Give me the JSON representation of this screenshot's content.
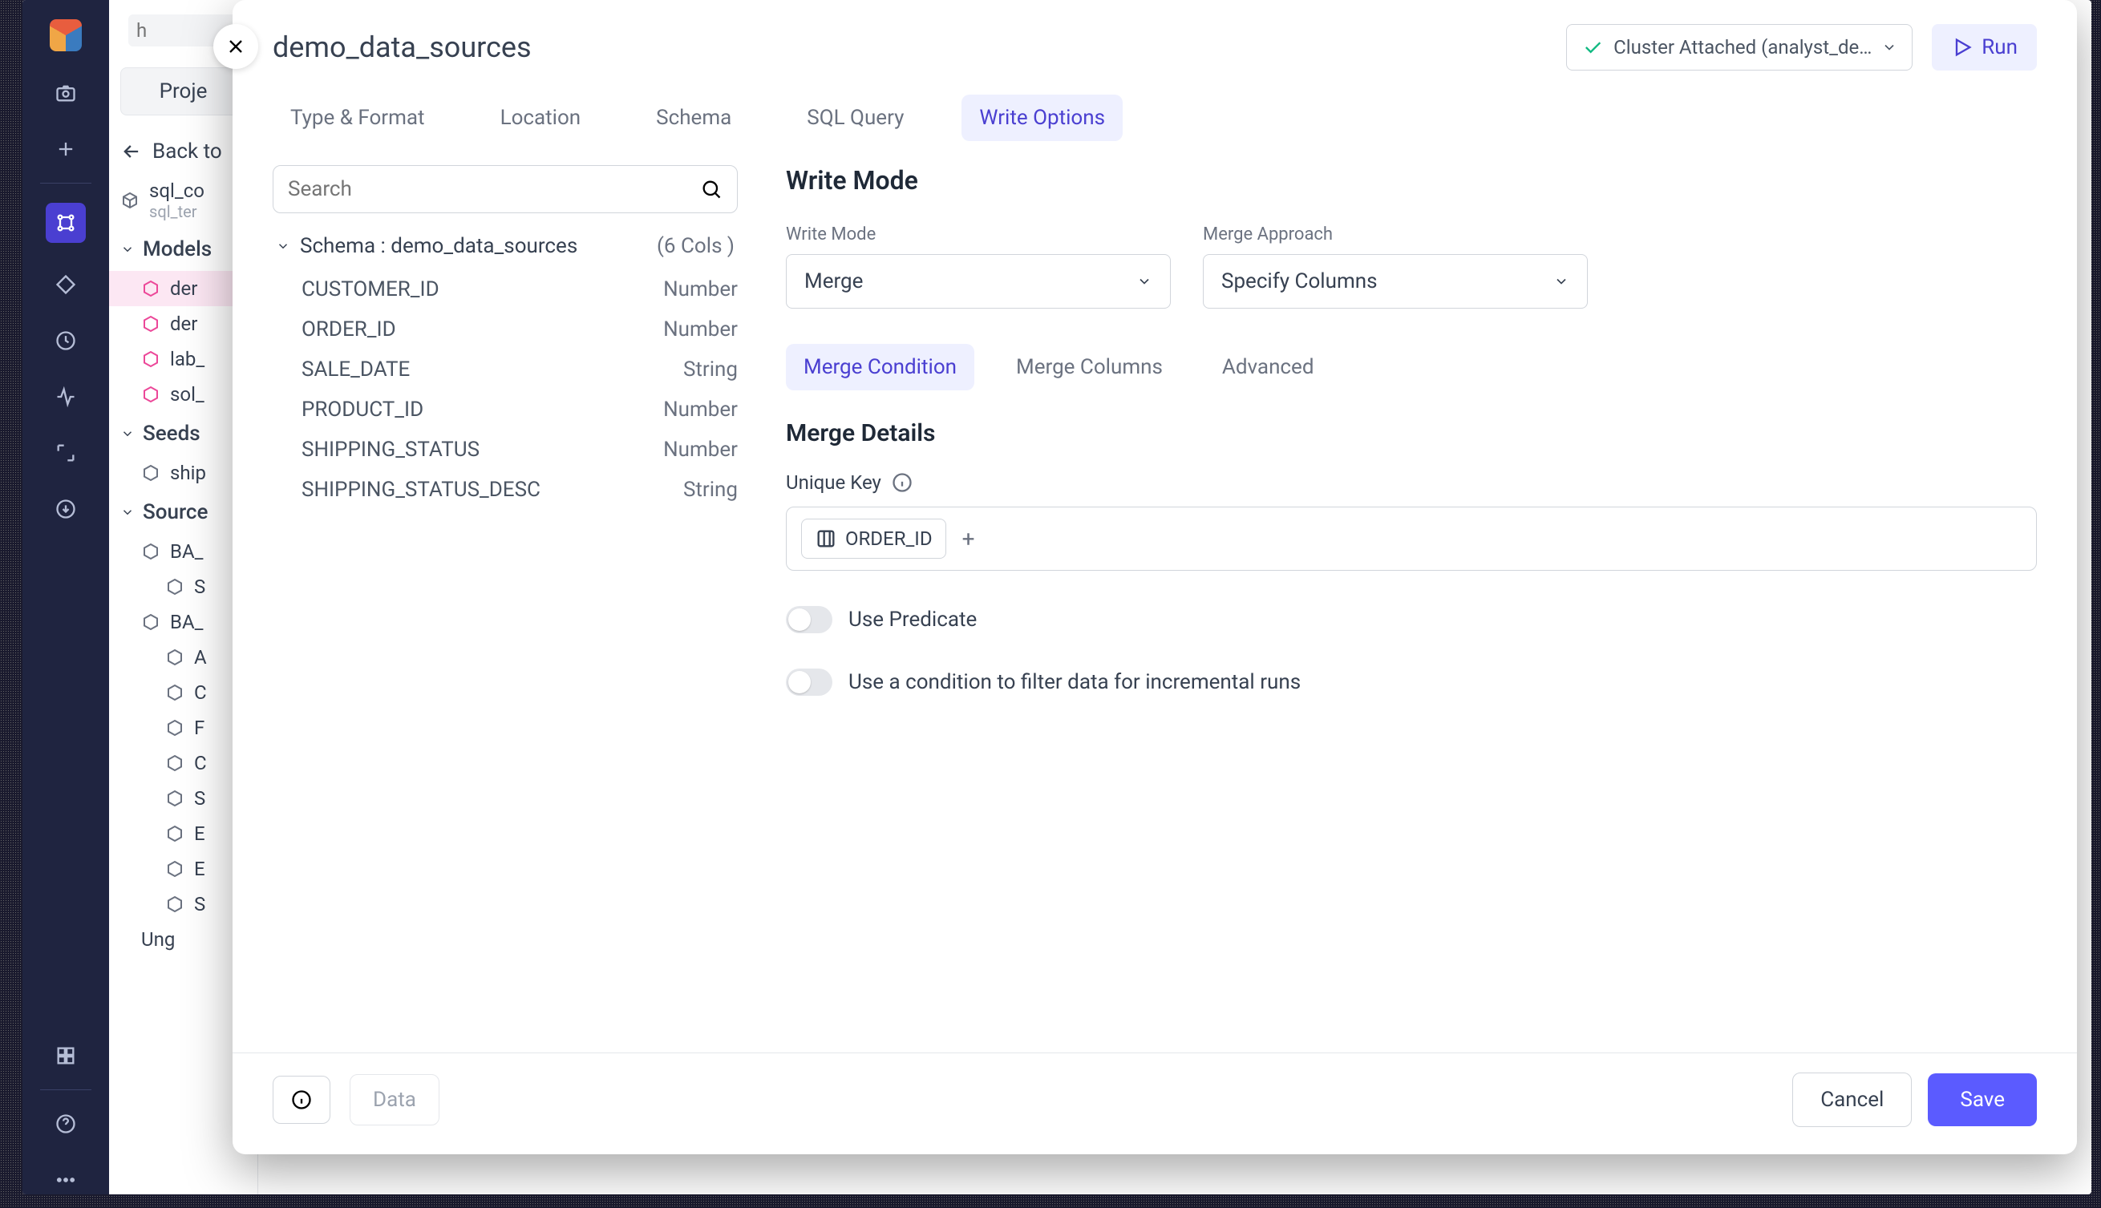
{
  "sidebar": {
    "search_ph": "h",
    "project_btn": "Proje",
    "back_label": "Back to",
    "file_title": "sql_co",
    "file_sub": "sql_ter",
    "sections": {
      "models": "Models",
      "seeds": "Seeds",
      "sources": "Source"
    },
    "models": [
      "der",
      "der",
      "lab_",
      "sol_"
    ],
    "seeds": [
      "ship"
    ],
    "sources_top": [
      "BA_",
      "S",
      "BA_"
    ],
    "sources_sub": [
      "A",
      "C",
      "F",
      "C",
      "S",
      "E",
      "E",
      "S"
    ],
    "sources_last": "Ung"
  },
  "modal": {
    "title": "demo_data_sources",
    "cluster": "Cluster Attached (analyst_de…",
    "run": "Run",
    "tabs": [
      "Type & Format",
      "Location",
      "Schema",
      "SQL Query",
      "Write Options"
    ],
    "active_tab": 4,
    "schema": {
      "search_ph": "Search",
      "head": "Schema : demo_data_sources",
      "cols": "(6 Cols )",
      "rows": [
        {
          "n": "CUSTOMER_ID",
          "t": "Number"
        },
        {
          "n": "ORDER_ID",
          "t": "Number"
        },
        {
          "n": "SALE_DATE",
          "t": "String"
        },
        {
          "n": "PRODUCT_ID",
          "t": "Number"
        },
        {
          "n": "SHIPPING_STATUS",
          "t": "Number"
        },
        {
          "n": "SHIPPING_STATUS_DESC",
          "t": "String"
        }
      ]
    },
    "write": {
      "h2": "Write Mode",
      "mode_label": "Write Mode",
      "mode_value": "Merge",
      "approach_label": "Merge Approach",
      "approach_value": "Specify Columns",
      "subtabs": [
        "Merge Condition",
        "Merge Columns",
        "Advanced"
      ],
      "active_subtab": 0,
      "h3": "Merge Details",
      "unique_key": "Unique Key",
      "key_chip": "ORDER_ID",
      "toggle1": "Use Predicate",
      "toggle2": "Use a condition to filter data for incremental runs"
    },
    "footer": {
      "data": "Data",
      "cancel": "Cancel",
      "save": "Save"
    }
  }
}
